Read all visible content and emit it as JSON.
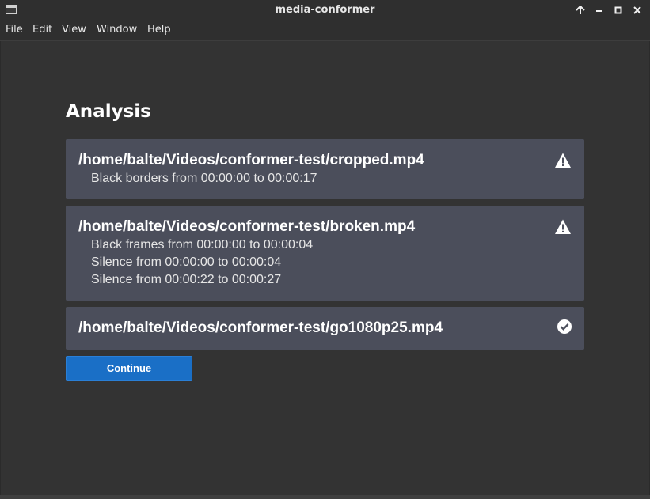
{
  "window": {
    "title": "media-conformer",
    "controls": [
      "up-arrow-icon",
      "minimize-icon",
      "maximize-icon",
      "close-icon"
    ]
  },
  "menu": {
    "items": [
      "File",
      "Edit",
      "View",
      "Window",
      "Help"
    ]
  },
  "main": {
    "heading": "Analysis",
    "results": [
      {
        "path": "/home/balte/Videos/conformer-test/cropped.mp4",
        "status_icon": "warning-icon",
        "issues": [
          "Black borders from 00:00:00 to 00:00:17"
        ]
      },
      {
        "path": "/home/balte/Videos/conformer-test/broken.mp4",
        "status_icon": "warning-icon",
        "issues": [
          "Black frames from 00:00:00 to 00:00:04",
          "Silence from 00:00:00 to 00:00:04",
          "Silence from 00:00:22 to 00:00:27"
        ]
      },
      {
        "path": "/home/balte/Videos/conformer-test/go1080p25.mp4",
        "status_icon": "check-circle-icon",
        "issues": []
      }
    ],
    "continue_label": "Continue"
  },
  "colors": {
    "card_bg": "#4b4e5b",
    "button_bg": "#1a6fc6",
    "window_bg": "#333333"
  }
}
